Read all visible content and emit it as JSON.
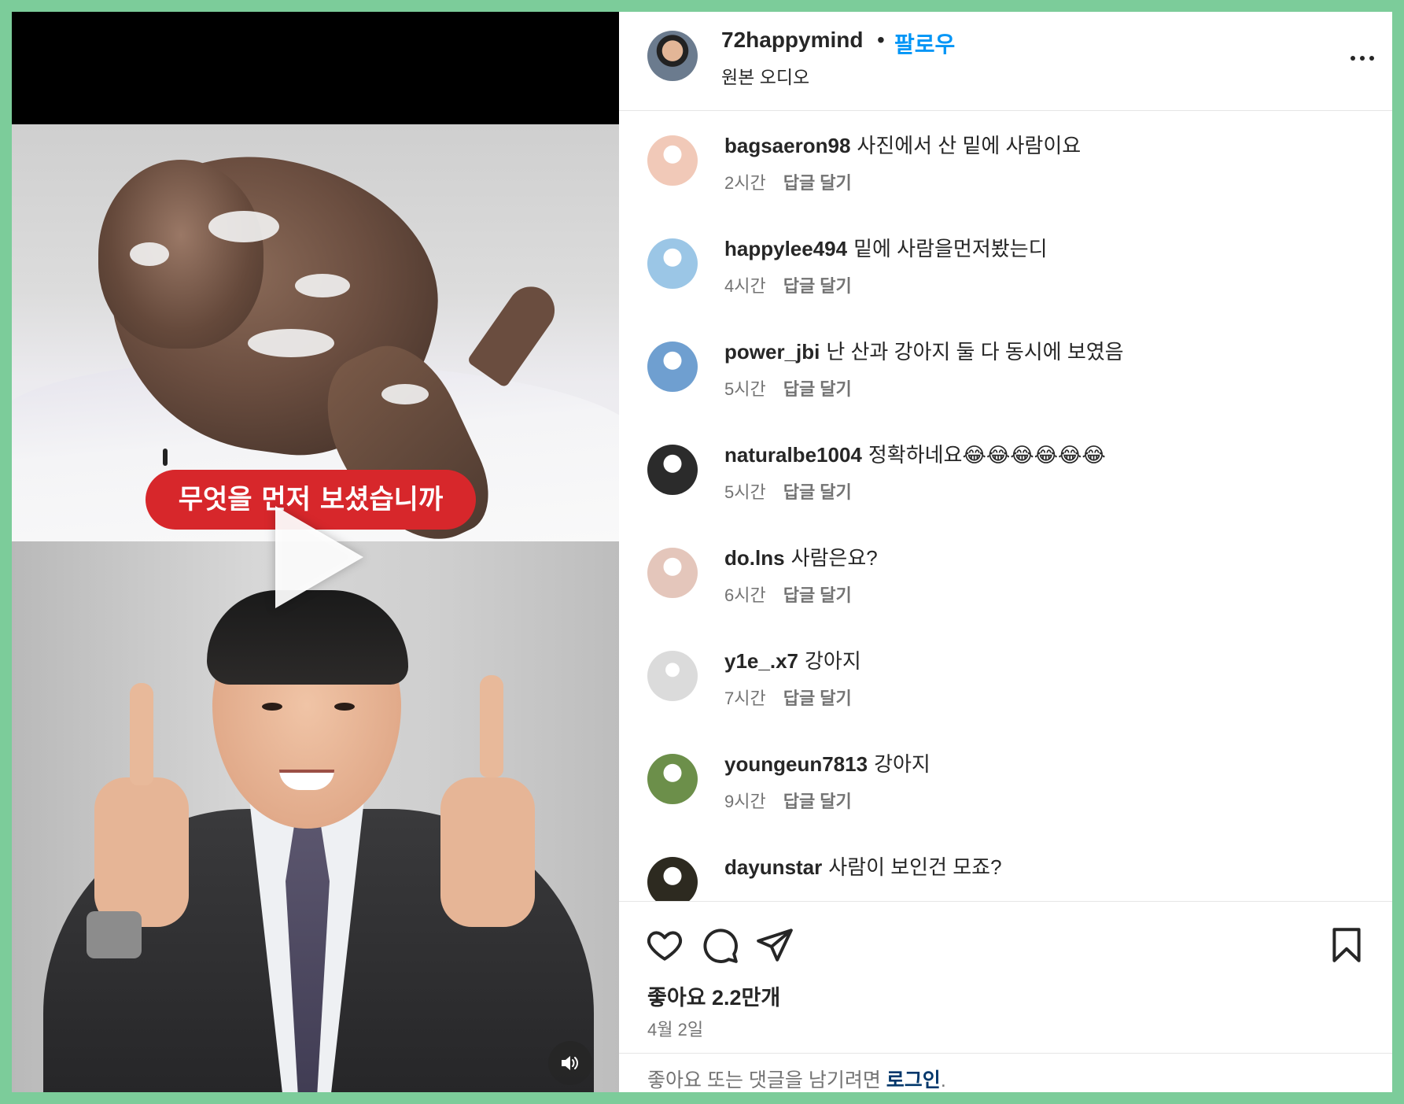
{
  "post": {
    "username": "72happymind",
    "separator": "•",
    "follow_label": "팔로우",
    "audio_label": "원본 오디오",
    "more_icon": "more-horizontal-icon"
  },
  "video": {
    "caption": "무엇을 먼저 보셨습니까",
    "play_icon": "play-icon",
    "mute_icon": "speaker-icon"
  },
  "comments": [
    {
      "username": "bagsaeron98",
      "text": "사진에서 산 밑에 사람이요",
      "time": "2시간",
      "reply": "답글 달기",
      "avatar_color": "#f1c9b8"
    },
    {
      "username": "happylee494",
      "text": "밑에 사람을먼저봤는디",
      "time": "4시간",
      "reply": "답글 달기",
      "avatar_color": "#9bc6e6"
    },
    {
      "username": "power_jbi",
      "text": "난 산과 강아지 둘 다 동시에 보였음",
      "time": "5시간",
      "reply": "답글 달기",
      "avatar_color": "#6f9fd0"
    },
    {
      "username": "naturalbe1004",
      "text": "정확하네요😂😂😂😂😂😂",
      "time": "5시간",
      "reply": "답글 달기",
      "avatar_color": "#2b2b2b"
    },
    {
      "username": "do.lns",
      "text": "사람은요?",
      "time": "6시간",
      "reply": "답글 달기",
      "avatar_color": "#e4c6bb"
    },
    {
      "username": "y1e_.x7",
      "text": "강아지",
      "time": "7시간",
      "reply": "답글 달기",
      "avatar_color": "#dbdbdb"
    },
    {
      "username": "youngeun7813",
      "text": "강아지",
      "time": "9시간",
      "reply": "답글 달기",
      "avatar_color": "#6c8f4a"
    },
    {
      "username": "dayunstar",
      "text": "사람이 보인건 모죠?",
      "time": "",
      "reply": "",
      "avatar_color": "#2d2a20"
    }
  ],
  "actions": {
    "like_icon": "heart-icon",
    "comment_icon": "comment-icon",
    "share_icon": "send-icon",
    "save_icon": "bookmark-icon",
    "likes": "좋아요 2.2만개",
    "date": "4월 2일"
  },
  "login": {
    "prefix": "좋아요 또는 댓글을 남기려면 ",
    "link": "로그인",
    "suffix": "."
  },
  "colors": {
    "page_border": "#7ccc9a",
    "follow": "#0095f6",
    "caption_pill": "#d7272b",
    "login_link": "#00376b"
  }
}
